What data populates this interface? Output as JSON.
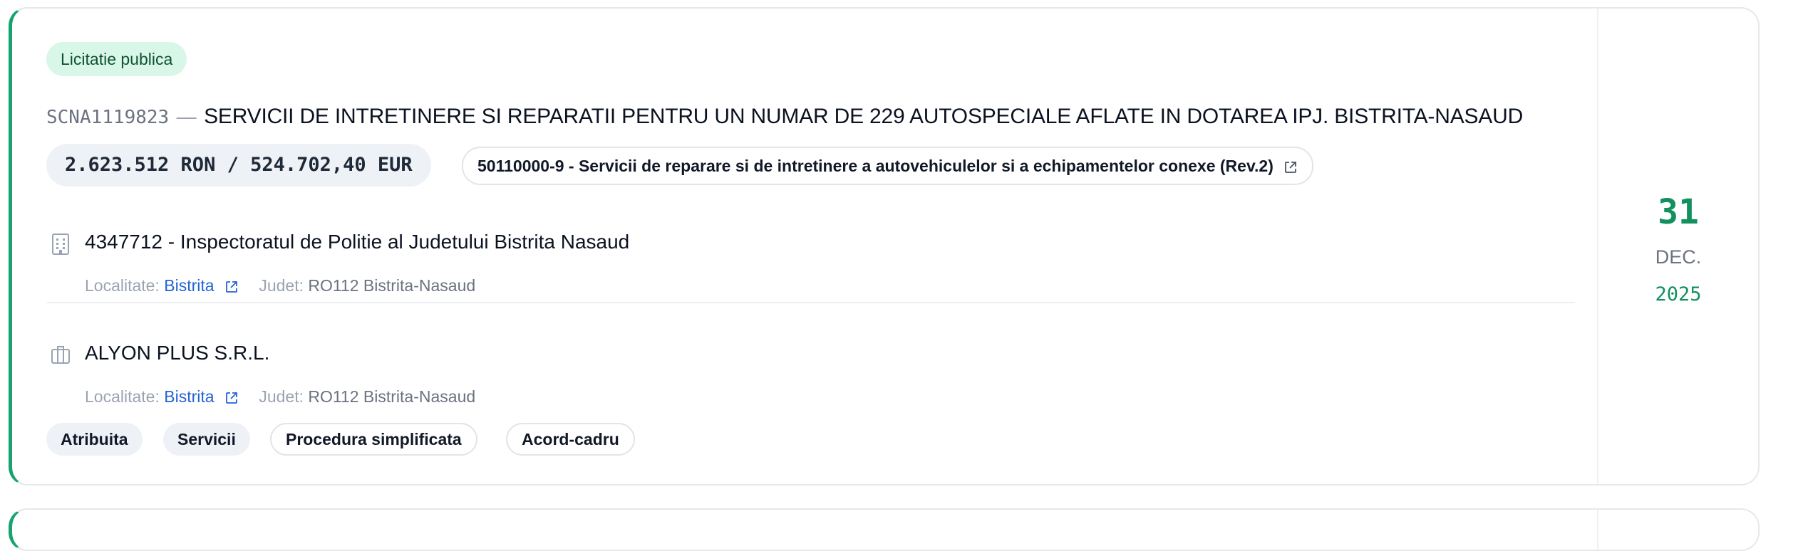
{
  "procedure_type": "Licitatie publica",
  "notice": {
    "code": "SCNA1119823",
    "separator": "—",
    "title": "SERVICII DE INTRETINERE SI REPARATII PENTRU UN NUMAR DE 229 AUTOSPECIALE AFLATE IN DOTAREA IPJ. BISTRITA-NASAUD"
  },
  "value": "2.623.512 RON / 524.702,40 EUR",
  "cpv": "50110000-9 - Servicii de reparare si de intretinere a autovehiculelor si a echipamentelor conexe (Rev.2)",
  "authority": {
    "name": "4347712 - Inspectoratul de Politie al Judetului Bistrita Nasaud",
    "locality_label": "Localitate:",
    "locality": "Bistrita",
    "county_label": "Judet:",
    "county": "RO112 Bistrita-Nasaud"
  },
  "supplier": {
    "name": "ALYON PLUS S.R.L.",
    "locality_label": "Localitate:",
    "locality": "Bistrita",
    "county_label": "Judet:",
    "county": "RO112 Bistrita-Nasaud"
  },
  "tags": [
    "Atribuita",
    "Servicii",
    "Procedura simplificata",
    "Acord-cadru"
  ],
  "date": {
    "day": "31",
    "month": "DEC.",
    "year": "2025"
  },
  "icons": {
    "authority": "building-icon",
    "supplier": "briefcase-icon",
    "external": "external-link-icon"
  },
  "colors": {
    "accent": "#16a370",
    "badge_bg": "#d9f7e8",
    "link": "#2463d6",
    "date": "#12905f"
  }
}
